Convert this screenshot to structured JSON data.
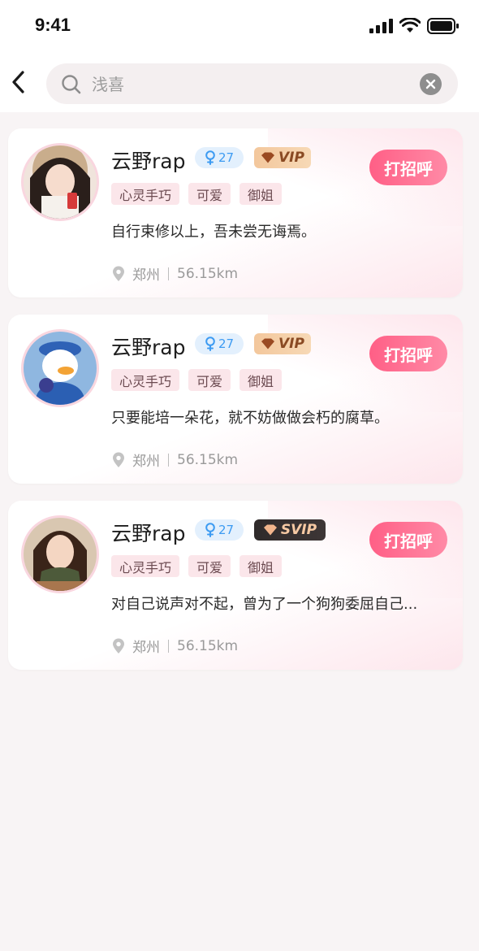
{
  "status_bar": {
    "time": "9:41"
  },
  "search": {
    "value": "",
    "placeholder": "浅喜"
  },
  "colors": {
    "accent": "#ff5f86",
    "age_badge": "#3d9bf2",
    "background": "#f8f4f5"
  },
  "results": [
    {
      "name": "云野rap",
      "gender_icon": "female-icon",
      "age": "27",
      "badge": "VIP",
      "greet_label": "打招呼",
      "tags": [
        "心灵手巧",
        "可爱",
        "御姐"
      ],
      "bio": "自行束修以上，吾未尝无诲焉。",
      "city": "郑州",
      "distance": "56.15km"
    },
    {
      "name": "云野rap",
      "gender_icon": "female-icon",
      "age": "27",
      "badge": "VIP",
      "greet_label": "打招呼",
      "tags": [
        "心灵手巧",
        "可爱",
        "御姐"
      ],
      "bio": "只要能培一朵花，就不妨做做会朽的腐草。",
      "city": "郑州",
      "distance": "56.15km"
    },
    {
      "name": "云野rap",
      "gender_icon": "female-icon",
      "age": "27",
      "badge": "SVIP",
      "greet_label": "打招呼",
      "tags": [
        "心灵手巧",
        "可爱",
        "御姐"
      ],
      "bio": "对自己说声对不起，曾为了一个狗狗委屈自己...",
      "city": "郑州",
      "distance": "56.15km"
    }
  ]
}
